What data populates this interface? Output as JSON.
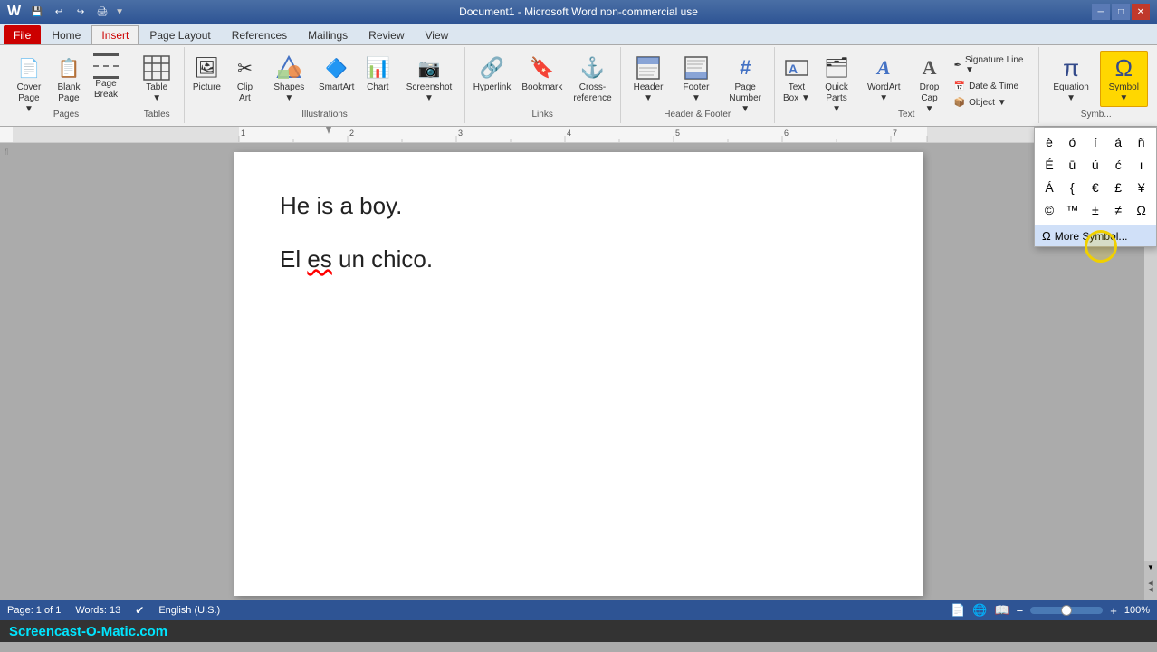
{
  "titlebar": {
    "title": "Document1 - Microsoft Word non-commercial use",
    "minimize_label": "─",
    "maximize_label": "□",
    "close_label": "✕"
  },
  "quickaccess": {
    "icons": [
      "💾",
      "↩",
      "↪",
      "🖨",
      ""
    ]
  },
  "tabs": [
    {
      "label": "File",
      "active": false
    },
    {
      "label": "Home",
      "active": false
    },
    {
      "label": "Insert",
      "active": true
    },
    {
      "label": "Page Layout",
      "active": false
    },
    {
      "label": "References",
      "active": false
    },
    {
      "label": "Mailings",
      "active": false
    },
    {
      "label": "Review",
      "active": false
    },
    {
      "label": "View",
      "active": false
    }
  ],
  "ribbon": {
    "groups": [
      {
        "name": "pages",
        "label": "Pages",
        "buttons": [
          {
            "id": "cover-page",
            "icon": "📄",
            "label": "Cover\nPage ▼"
          },
          {
            "id": "blank-page",
            "icon": "📋",
            "label": "Blank\nPage"
          },
          {
            "id": "page-break",
            "icon": "⬛",
            "label": "Page\nBreak"
          }
        ]
      },
      {
        "name": "tables",
        "label": "Tables",
        "buttons": [
          {
            "id": "table",
            "icon": "⊞",
            "label": "Table ▼"
          }
        ]
      },
      {
        "name": "illustrations",
        "label": "Illustrations",
        "buttons": [
          {
            "id": "picture",
            "icon": "🖼",
            "label": "Picture"
          },
          {
            "id": "clip-art",
            "icon": "✂",
            "label": "Clip\nArt"
          },
          {
            "id": "shapes",
            "icon": "△",
            "label": "Shapes ▼"
          },
          {
            "id": "smartart",
            "icon": "🔷",
            "label": "SmartArt"
          },
          {
            "id": "chart",
            "icon": "📊",
            "label": "Chart"
          },
          {
            "id": "screenshot",
            "icon": "📷",
            "label": "Screenshot ▼"
          }
        ]
      },
      {
        "name": "links",
        "label": "Links",
        "buttons": [
          {
            "id": "hyperlink",
            "icon": "🔗",
            "label": "Hyperlink"
          },
          {
            "id": "bookmark",
            "icon": "🔖",
            "label": "Bookmark"
          },
          {
            "id": "cross-reference",
            "icon": "⚓",
            "label": "Cross-\nreference"
          }
        ]
      },
      {
        "name": "header-footer",
        "label": "Header & Footer",
        "buttons": [
          {
            "id": "header",
            "icon": "📝",
            "label": "Header ▼"
          },
          {
            "id": "footer",
            "icon": "📝",
            "label": "Footer ▼"
          },
          {
            "id": "page-number",
            "icon": "#",
            "label": "Page\nNumber ▼"
          }
        ]
      },
      {
        "name": "text",
        "label": "Text",
        "buttons": [
          {
            "id": "text-box",
            "icon": "Ａ",
            "label": "Text\nBox ▼"
          },
          {
            "id": "quick-parts",
            "icon": "🗂",
            "label": "Quick\nParts ▼"
          },
          {
            "id": "wordart",
            "icon": "Ａ",
            "label": "WordArt ▼"
          },
          {
            "id": "drop-cap",
            "icon": "Ａ",
            "label": "Drop\nCap ▼"
          },
          {
            "id": "signature-line",
            "icon": "✒",
            "label": "Signature Line ▼"
          },
          {
            "id": "date-time",
            "icon": "📅",
            "label": "Date & Time"
          },
          {
            "id": "object",
            "icon": "📦",
            "label": "Object ▼"
          }
        ]
      },
      {
        "name": "symbols",
        "label": "Symb...",
        "buttons": [
          {
            "id": "equation",
            "icon": "π",
            "label": "Equation ▼"
          },
          {
            "id": "symbol",
            "icon": "Ω",
            "label": "Symbol ▼"
          }
        ]
      }
    ]
  },
  "symbol_dropdown": {
    "visible": true,
    "symbols": [
      "è",
      "ó",
      "í",
      "á",
      "ñ",
      "É",
      "ū",
      "ú",
      "ć",
      "ı",
      "Á",
      "{",
      "€",
      "£",
      "¥",
      "©",
      "™",
      "±",
      "≠",
      "Ω"
    ],
    "more_label": "More Symbol...",
    "omega_icon": "Ω"
  },
  "document": {
    "lines": [
      "He is a boy.",
      "El es un chico."
    ]
  },
  "statusbar": {
    "page": "Page: 1 of 1",
    "words": "Words: 13",
    "language": "English (U.S.)",
    "zoom": "100%",
    "view_icons": [
      "📄",
      "📄",
      "📄"
    ]
  },
  "watermark": {
    "text": "Screencast-O-Matic.com"
  }
}
